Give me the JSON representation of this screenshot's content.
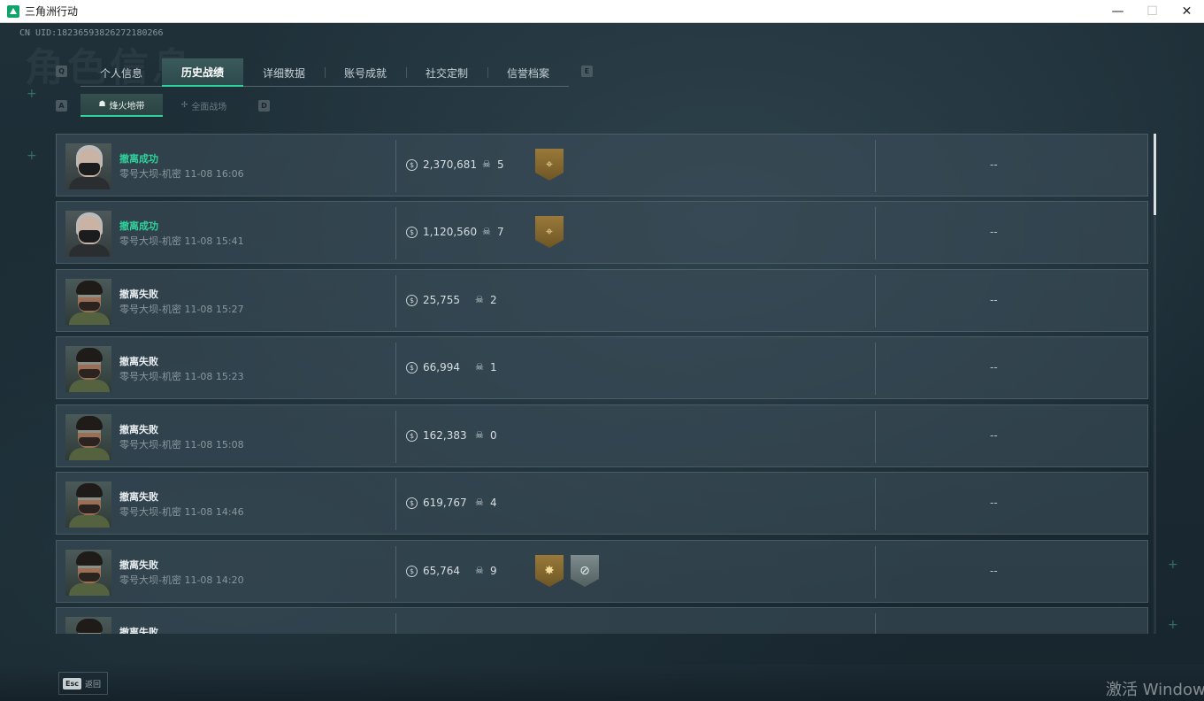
{
  "window": {
    "title": "三角洲行动",
    "controls": {
      "minimize": "—",
      "maximize": "☐",
      "close": "✕"
    }
  },
  "header": {
    "uid": "CN UID:18236593826272180266",
    "watermark": "角色信息",
    "key_prev_tab": "Q",
    "key_next_tab": "E",
    "key_prev_sub": "A",
    "key_next_sub": "D"
  },
  "main_tabs": [
    {
      "label": "个人信息"
    },
    {
      "label": "历史战绩",
      "active": true
    },
    {
      "label": "详细数据"
    },
    {
      "label": "账号成就"
    },
    {
      "label": "社交定制"
    },
    {
      "label": "信誉档案"
    }
  ],
  "sub_tabs": [
    {
      "label": "烽火地带",
      "icon": "☗",
      "active": true
    },
    {
      "label": "全面战场",
      "icon": "✢"
    }
  ],
  "records": [
    {
      "status": "撤离成功",
      "result": "success",
      "map": "零号大坝-机密 11-08 16:06",
      "value": "2,370,681",
      "kills": "5",
      "operator": "female",
      "badges": [
        "gold-crosshair"
      ],
      "extra": "--"
    },
    {
      "status": "撤离成功",
      "result": "success",
      "map": "零号大坝-机密 11-08 15:41",
      "value": "1,120,560",
      "kills": "7",
      "operator": "female",
      "badges": [
        "gold-crosshair"
      ],
      "extra": "--"
    },
    {
      "status": "撤离失败",
      "result": "fail",
      "map": "零号大坝-机密 11-08 15:27",
      "value": "25,755",
      "kills": "2",
      "operator": "male",
      "badges": [],
      "extra": "--"
    },
    {
      "status": "撤离失败",
      "result": "fail",
      "map": "零号大坝-机密 11-08 15:23",
      "value": "66,994",
      "kills": "1",
      "operator": "male",
      "badges": [],
      "extra": "--"
    },
    {
      "status": "撤离失败",
      "result": "fail",
      "map": "零号大坝-机密 11-08 15:08",
      "value": "162,383",
      "kills": "0",
      "operator": "male",
      "badges": [],
      "extra": "--"
    },
    {
      "status": "撤离失败",
      "result": "fail",
      "map": "零号大坝-机密 11-08 14:46",
      "value": "619,767",
      "kills": "4",
      "operator": "male",
      "badges": [],
      "extra": "--"
    },
    {
      "status": "撤离失败",
      "result": "fail",
      "map": "零号大坝-机密 11-08 14:20",
      "value": "65,764",
      "kills": "9",
      "operator": "male",
      "badges": [
        "gold-star",
        "silver-crosshair"
      ],
      "extra": "--"
    },
    {
      "status": "撤离失败",
      "result": "fail",
      "map": "",
      "value": "",
      "kills": "",
      "operator": "male",
      "badges": [],
      "extra": ""
    }
  ],
  "footer": {
    "esc_key": "Esc",
    "back_label": "返回",
    "windows_activation": "激活 Windows"
  },
  "colors": {
    "accent": "#2fd39b",
    "success": "#2fd39b",
    "row_bg": "#3c4e58"
  },
  "icons": {
    "value": "coin-icon",
    "kills": "skull-icon"
  }
}
